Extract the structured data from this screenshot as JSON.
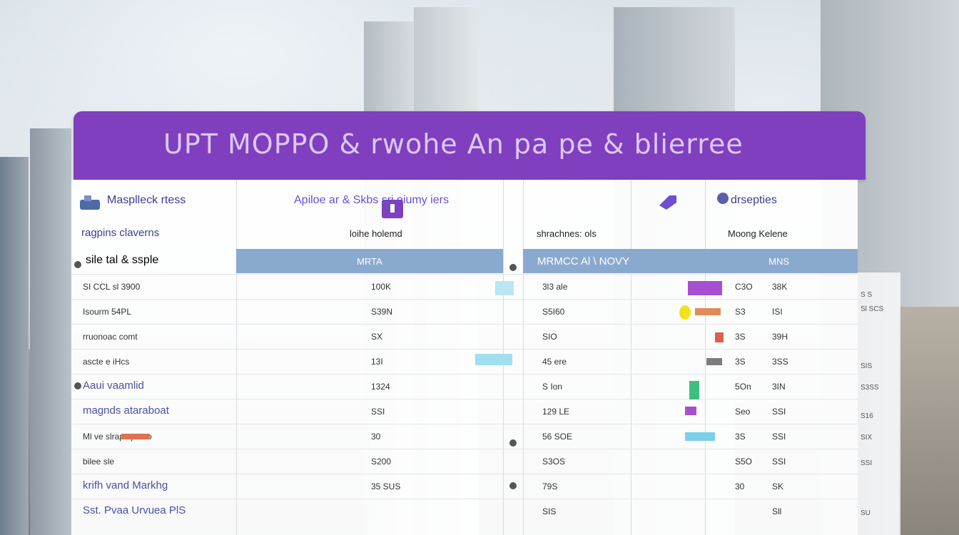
{
  "banner": {
    "title": "UPT  MOPPO &  rwohe An pa pe & blierree"
  },
  "columns": [
    {
      "head": "Masplleck rtess",
      "sub": "ragpins claverns"
    },
    {
      "head": "Apiloe ar &  Skbs sri oiumy iers",
      "sub": "loihe holemd"
    },
    {
      "head": "",
      "sub": "shrachnes: ols"
    },
    {
      "head": "drsepties",
      "sub": "Moong  Kelene"
    }
  ],
  "subheader": {
    "left": "sile      tal  &  ssple",
    "mid": "MRTA",
    "right": "MRMCC  Al  \\  NOVY",
    "far": "MNS"
  },
  "rows": [
    {
      "label": "SI CCL    sl 3900",
      "v1": "100K",
      "v2": "3l3 ale",
      "v3": "C3O",
      "v4": "38K",
      "big": false
    },
    {
      "label": "Isourm  54PL",
      "v1": "S39N",
      "v2": "S5I60",
      "v3": "S3",
      "v4": "ISI",
      "big": false
    },
    {
      "label": "rruonoac  comt",
      "v1": "SX",
      "v2": "SIO",
      "v3": "3S",
      "v4": "39H",
      "big": false
    },
    {
      "label": "ascte    e iHcs",
      "v1": "13I",
      "v2": "45 ere",
      "v3": "3S",
      "v4": "3SS",
      "big": false
    },
    {
      "label": "Aaui vaamlid",
      "v1": "1324",
      "v2": "S Ion",
      "v3": "5On",
      "v4": "3IN",
      "big": true
    },
    {
      "label": "magnds ataraboat",
      "v1": "SSI",
      "v2": "129 LE",
      "v3": "Seo",
      "v4": "SSI",
      "big": true
    },
    {
      "label": "Ml  ve    slrap   spesto",
      "v1": "30",
      "v2": "56 SOE",
      "v3": "3S",
      "v4": "SSI",
      "big": false
    },
    {
      "label": "bilee     sle",
      "v1": "S200",
      "v2": "S3OS",
      "v3": "S5O",
      "v4": "SSI",
      "big": false
    },
    {
      "label": "krifh vand Markhg",
      "v1": "35  SUS",
      "v2": "79S",
      "v3": "30",
      "v4": "SK",
      "big": true
    },
    {
      "label": "Sst.  Pvaa  Urvuea  PlS",
      "v1": "",
      "v2": "SIS",
      "v3": "",
      "v4": "Sll",
      "big": true
    }
  ],
  "side": [
    "S S",
    "Sl SCS",
    "",
    "SIS",
    "S3SS",
    "S16",
    "SIX",
    "SSI",
    "",
    "SU"
  ],
  "colors": {
    "banner": "#7f3fbf",
    "subheader": "#8aa9cf",
    "accent_text": "#4a4fa3"
  }
}
